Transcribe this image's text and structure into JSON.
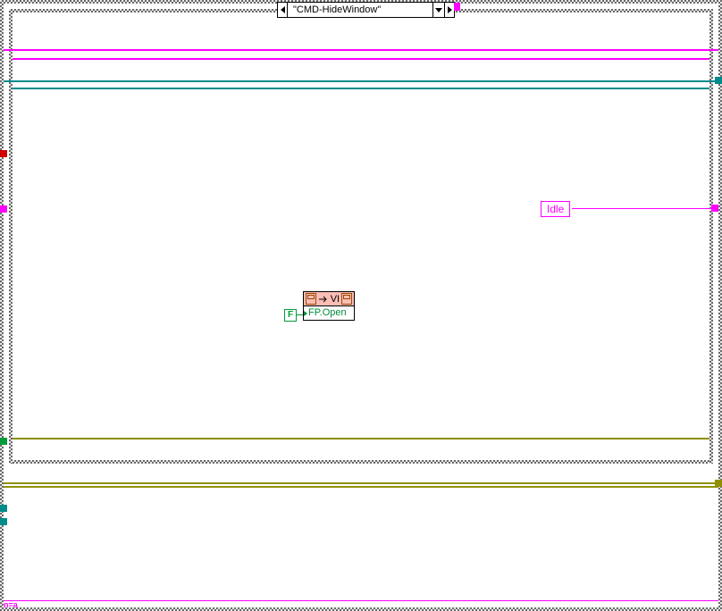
{
  "case_selector": {
    "value": "\"CMD-HideWindow\""
  },
  "invoke_node": {
    "class": "VI",
    "method": "FP.Open"
  },
  "bool_constant": {
    "value": "F"
  },
  "enum_constant": {
    "value": "Idle"
  },
  "corner_label": "n=a",
  "colors": {
    "magenta": "#ff00ff",
    "teal": "#008b8b",
    "olive": "#8f8f00",
    "green": "#008b3a",
    "salmon": "#fcbdb5"
  }
}
